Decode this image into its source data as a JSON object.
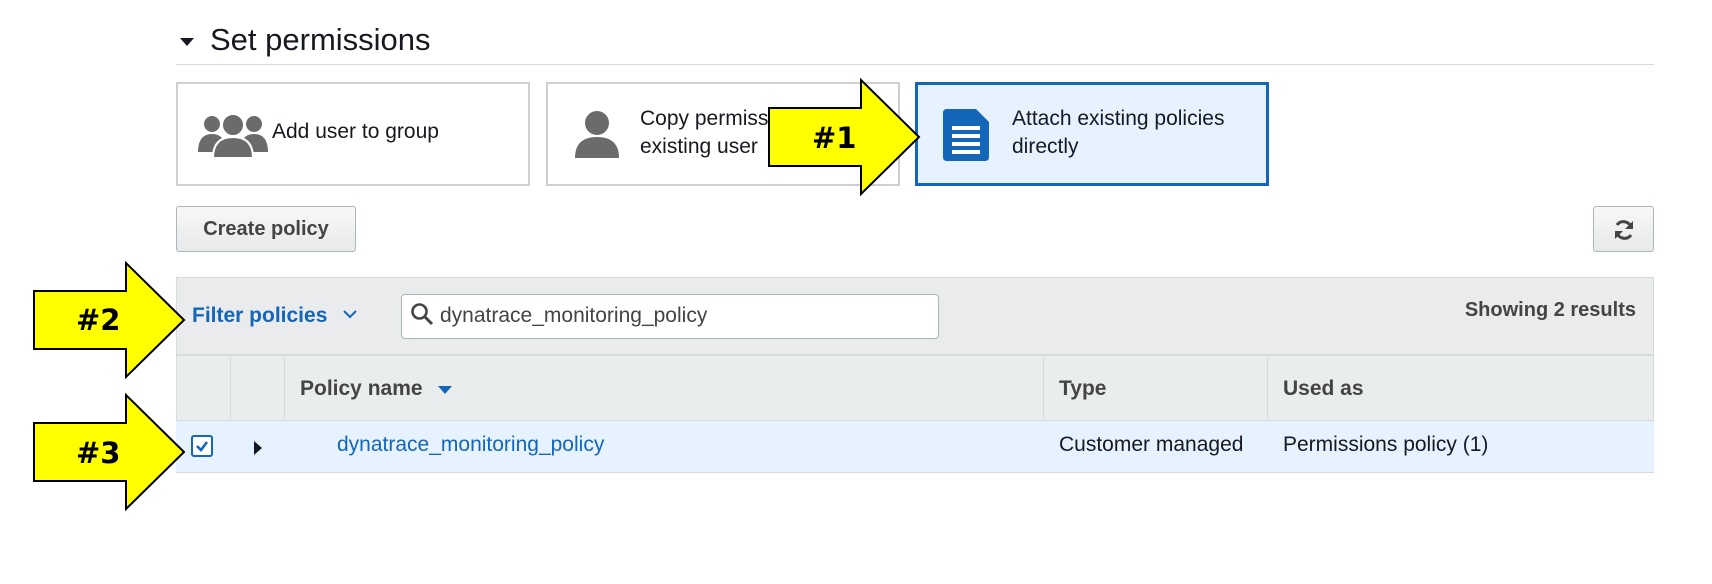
{
  "section": {
    "title": "Set permissions"
  },
  "options": [
    {
      "label_line1": "Add user to group",
      "label_line2": "",
      "icon": "user-group-icon"
    },
    {
      "label_line1": "Copy permiss",
      "label_line2": "existing user",
      "icon": "user-icon"
    },
    {
      "label_line1": "Attach existing policies",
      "label_line2": "directly",
      "icon": "document-icon",
      "selected": true
    }
  ],
  "toolbar": {
    "create_policy_label": "Create policy",
    "refresh_icon": "refresh-icon"
  },
  "filter": {
    "label": "Filter policies",
    "search_value": "dynatrace_monitoring_policy",
    "result_count": "Showing 2 results"
  },
  "table": {
    "columns": [
      "Policy name",
      "Type",
      "Used as"
    ],
    "rows": [
      {
        "checked": true,
        "name": "dynatrace_monitoring_policy",
        "type": "Customer managed",
        "used_as": "Permissions policy (1)"
      }
    ]
  },
  "callouts": [
    "#1",
    "#2",
    "#3"
  ],
  "colors": {
    "accent": "#1466b8",
    "selected_bg": "#e6f2ff",
    "callout": "#ffff00"
  }
}
